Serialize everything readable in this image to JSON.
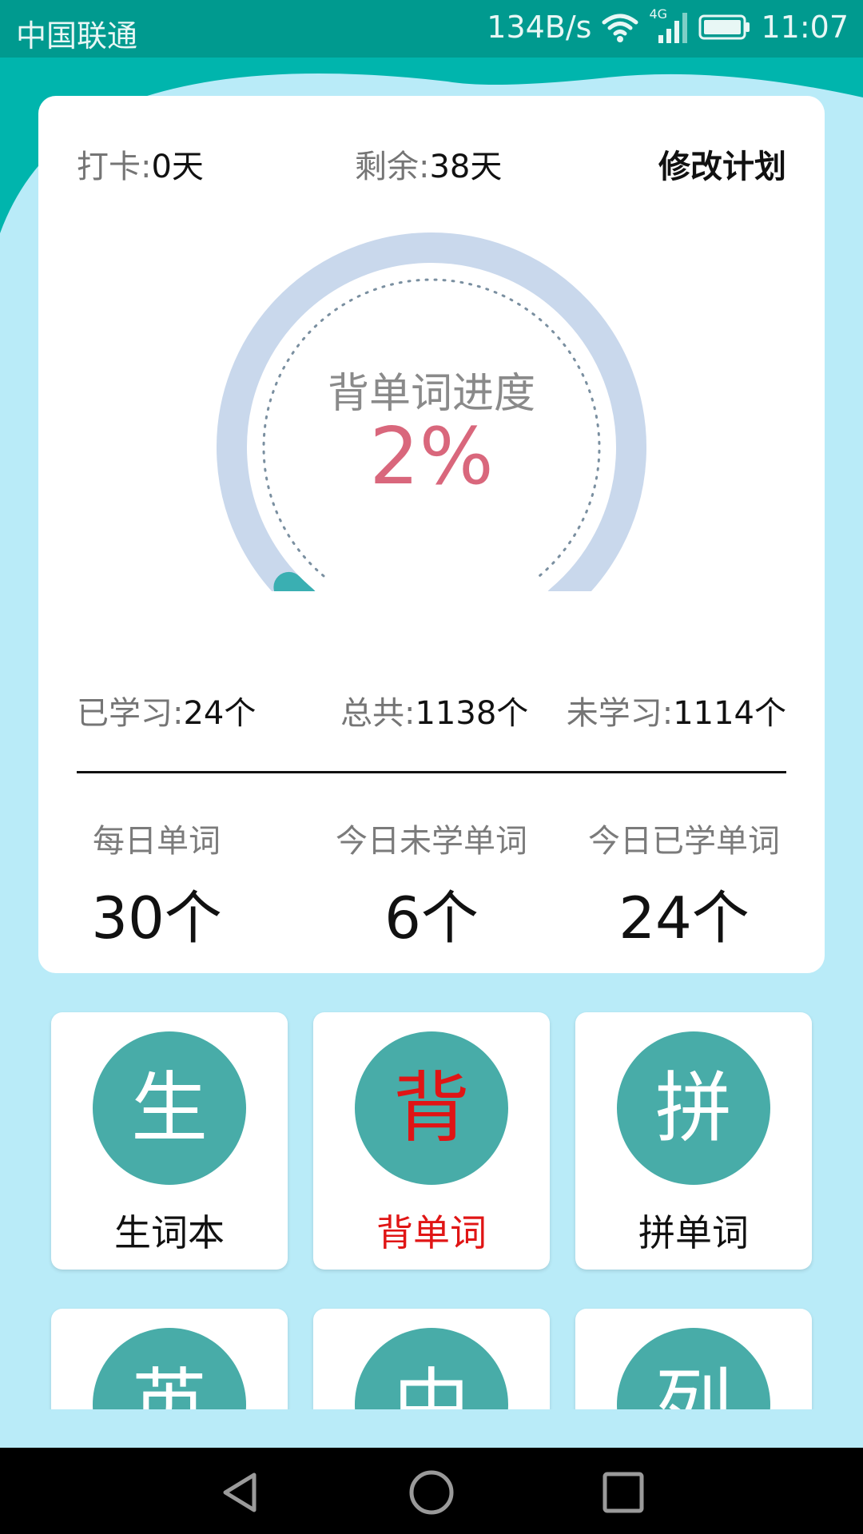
{
  "status_bar": {
    "carrier": "中国联通",
    "speed": "134B/s",
    "network": "4G",
    "time": "11:07"
  },
  "plan": {
    "checkin_label": "打卡:",
    "checkin_value": "0天",
    "remaining_label": "剩余:",
    "remaining_value": "38天",
    "modify_label": "修改计划"
  },
  "progress": {
    "title": "背单词进度",
    "value_text": "2%",
    "value": 0.02
  },
  "counts": {
    "learned_label": "已学习:",
    "learned_value": "24个",
    "total_label": "总共:",
    "total_value": "1138个",
    "unlearned_label": "未学习:",
    "unlearned_value": "1114个"
  },
  "daily": [
    {
      "title": "每日单词",
      "value": "30个"
    },
    {
      "title": "今日未学单词",
      "value": "6个"
    },
    {
      "title": "今日已学单词",
      "value": "24个"
    }
  ],
  "tiles": [
    {
      "char": "生",
      "label": "生词本",
      "active": false
    },
    {
      "char": "背",
      "label": "背单词",
      "active": true
    },
    {
      "char": "拼",
      "label": "拼单词",
      "active": false
    },
    {
      "char": "英",
      "label": "",
      "active": false
    },
    {
      "char": "中",
      "label": "",
      "active": false
    },
    {
      "char": "列",
      "label": "",
      "active": false
    }
  ],
  "colors": {
    "status_bar": "#009a8f",
    "background": "#b9ebf8",
    "gauge_track": "#c9d8ec",
    "gauge_progress": "#3aafb2",
    "progress_text": "#d9677c",
    "tile_circle": "#48aca8",
    "active_red": "#e01515"
  },
  "nav": {
    "icons": [
      "back-icon",
      "home-icon",
      "recents-icon"
    ]
  }
}
